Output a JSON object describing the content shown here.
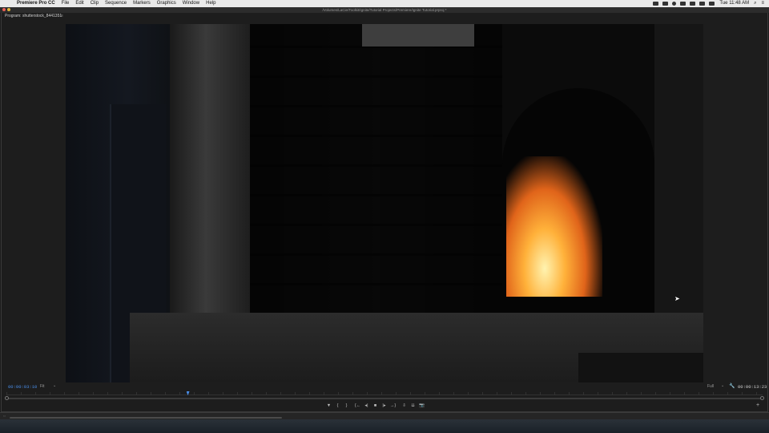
{
  "menubar": {
    "apple": "",
    "app_name": "Premiere Pro CC",
    "items": [
      "File",
      "Edit",
      "Clip",
      "Sequence",
      "Markers",
      "Graphics",
      "Window",
      "Help"
    ],
    "clock": "Tue 11:48 AM",
    "search_glyph": "⌕",
    "list_glyph": "≡"
  },
  "window": {
    "title": "/Volumes/LaCie/Toolkit/Ignite/Tutorial Projects/Premiere/Ignite Tutorial.prproj *"
  },
  "monitor": {
    "panel_label": "Program: shutterstock_8441351",
    "panel_menu": "≡",
    "current_time": "00:00:03:10",
    "fit_label": "Fit",
    "resolution_label": "Full",
    "dropdown_glyph": "⌄",
    "wrench_glyph": "🔧",
    "duration": "00:00:13:23",
    "playhead_progress": 0.24
  },
  "transport": {
    "marker": "▼",
    "in": "{",
    "out": "}",
    "go_in": "{←",
    "step_back": "◂|",
    "stop": "■",
    "step_fwd": "|▸",
    "go_out": "→}",
    "insert": "⇩",
    "overwrite": "⇊",
    "camera": "📷",
    "add": "+"
  },
  "bottom": {
    "scroll_glyph": "⇔"
  }
}
